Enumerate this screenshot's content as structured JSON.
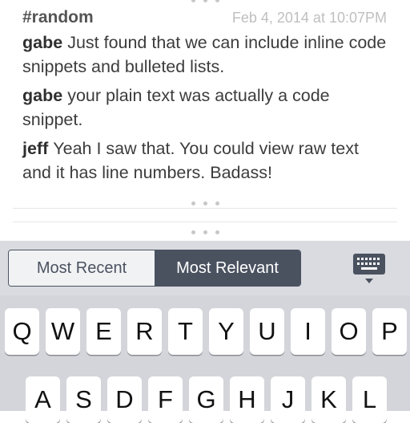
{
  "card": {
    "channel": "#random",
    "timestamp": "Feb 4, 2014 at 10:07PM",
    "messages": [
      {
        "author": "gabe",
        "text": "Just found that we can include inline code snippets and bulleted lists."
      },
      {
        "author": "gabe",
        "text": "your plain text was actually a code snippet."
      },
      {
        "author": "jeff",
        "text": "Yeah I saw that.  You could view raw text and it has line numbers.  Badass!"
      }
    ]
  },
  "filter": {
    "options": [
      "Most Recent",
      "Most Relevant"
    ],
    "selected": "Most Relevant"
  },
  "keyboard_toggle_icon": "keyboard-hide-icon",
  "keyboard": {
    "row1": [
      "Q",
      "W",
      "E",
      "R",
      "T",
      "Y",
      "U",
      "I",
      "O",
      "P"
    ],
    "row2": [
      "A",
      "S",
      "D",
      "F",
      "G",
      "H",
      "J",
      "K",
      "L"
    ]
  },
  "colors": {
    "segment_active": "#4a5260",
    "keyboard_bg": "#d3d5da",
    "key_bg": "#ffffff"
  }
}
